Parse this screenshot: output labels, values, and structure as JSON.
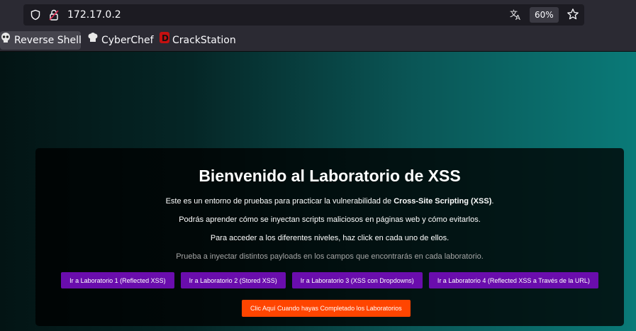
{
  "browser": {
    "url": "172.17.0.2",
    "zoom": "60%",
    "bookmarks": [
      {
        "label": "Reverse Shell",
        "icon": "skull-icon"
      },
      {
        "label": "CyberChef",
        "icon": "chef-hat-icon"
      },
      {
        "label": "CrackStation",
        "icon": "crackstation-d-icon"
      }
    ]
  },
  "page": {
    "title": "Bienvenido al Laboratorio de XSS",
    "intro_prefix": "Este es un entorno de pruebas para practicar la vulnerabilidad de ",
    "intro_strong": "Cross-Site Scripting (XSS)",
    "intro_suffix": ".",
    "line2": "Podrás aprender cómo se inyectan scripts maliciosos en páginas web y cómo evitarlos.",
    "line3": "Para acceder a los diferentes niveles, haz click en cada uno de ellos.",
    "hint": "Prueba a inyectar distintos payloads en los campos que encontrarás en cada laboratorio.",
    "buttons": [
      "Ir a Laboratorio 1 (Reflected XSS)",
      "Ir a Laboratorio 2 (Stored XSS)",
      "Ir a Laboratorio 3 (XSS con Dropdowns)",
      "Ir a Laboratorio 4 (Reflected XSS a Través de la URL)"
    ],
    "done_button": "Clic Aquí Cuando hayas Completado los Laboratorios"
  },
  "colors": {
    "lab_button": "#6a0dad",
    "done_button": "#ff4500"
  }
}
